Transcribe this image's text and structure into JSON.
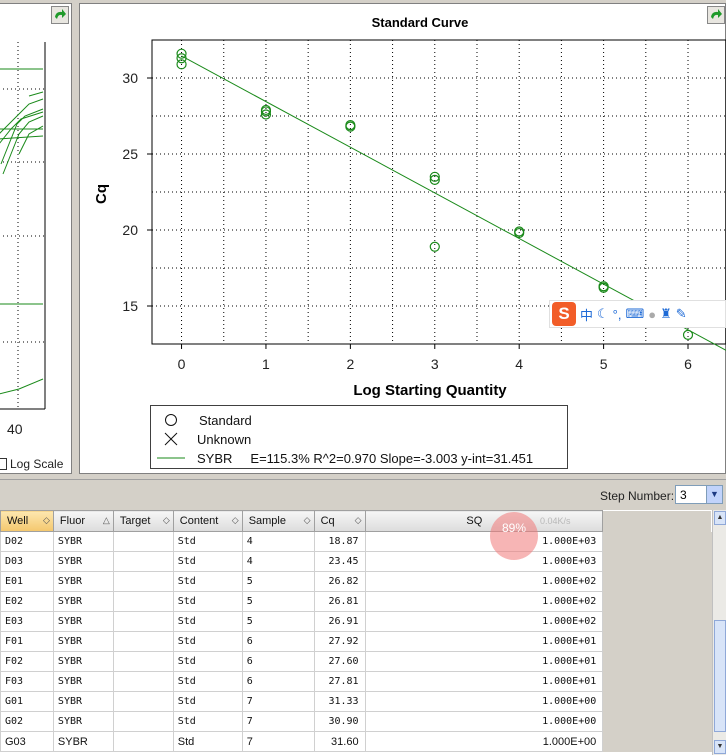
{
  "left_panel": {
    "x_tick": "40",
    "log_scale_label": "Log Scale"
  },
  "chart_data": {
    "type": "scatter",
    "title": "Standard Curve",
    "xlabel": "Log Starting Quantity",
    "ylabel": "Cq",
    "xlim": [
      -0.35,
      6.45
    ],
    "ylim": [
      12.5,
      32.5
    ],
    "x_ticks": [
      "0",
      "1",
      "2",
      "3",
      "4",
      "5",
      "6"
    ],
    "y_ticks": [
      "15",
      "20",
      "25",
      "30"
    ],
    "grid": true,
    "color": "#1a8a1a",
    "points": [
      [
        0,
        31.6
      ],
      [
        0,
        31.3
      ],
      [
        0,
        30.9
      ],
      [
        1,
        27.9
      ],
      [
        1,
        27.8
      ],
      [
        1,
        27.6
      ],
      [
        2,
        26.9
      ],
      [
        2,
        26.8
      ],
      [
        3,
        23.5
      ],
      [
        3,
        23.3
      ],
      [
        3,
        18.9
      ],
      [
        4,
        19.9
      ],
      [
        4,
        19.8
      ],
      [
        5,
        16.3
      ],
      [
        5,
        16.2
      ],
      [
        6,
        13.1
      ]
    ],
    "fit_line": {
      "slope": -3.003,
      "intercept": 31.451
    },
    "legend": [
      {
        "symbol": "circle",
        "label": "Standard"
      },
      {
        "symbol": "cross",
        "label": "Unknown"
      },
      {
        "symbol": "line",
        "label": "SYBR",
        "stats": "E=115.3% R^2=0.970 Slope=-3.003 y-int=31.451"
      }
    ],
    "legend_position": "bottom"
  },
  "step": {
    "label": "Step Number:",
    "value": "3"
  },
  "table": {
    "headers": [
      "Well",
      "Fluor",
      "Target",
      "Content",
      "Sample",
      "Cq",
      "SQ"
    ],
    "rows": [
      [
        "D02",
        "SYBR",
        "",
        "Std",
        "4",
        "18.87",
        "1.000E+03"
      ],
      [
        "D03",
        "SYBR",
        "",
        "Std",
        "4",
        "23.45",
        "1.000E+03"
      ],
      [
        "E01",
        "SYBR",
        "",
        "Std",
        "5",
        "26.82",
        "1.000E+02"
      ],
      [
        "E02",
        "SYBR",
        "",
        "Std",
        "5",
        "26.81",
        "1.000E+02"
      ],
      [
        "E03",
        "SYBR",
        "",
        "Std",
        "5",
        "26.91",
        "1.000E+02"
      ],
      [
        "F01",
        "SYBR",
        "",
        "Std",
        "6",
        "27.92",
        "1.000E+01"
      ],
      [
        "F02",
        "SYBR",
        "",
        "Std",
        "6",
        "27.60",
        "1.000E+01"
      ],
      [
        "F03",
        "SYBR",
        "",
        "Std",
        "6",
        "27.81",
        "1.000E+01"
      ],
      [
        "G01",
        "SYBR",
        "",
        "Std",
        "7",
        "31.33",
        "1.000E+00"
      ],
      [
        "G02",
        "SYBR",
        "",
        "Std",
        "7",
        "30.90",
        "1.000E+00"
      ],
      [
        "G03",
        "SYBR",
        "",
        "Std",
        "7",
        "31.60",
        "1.000E+00"
      ]
    ]
  },
  "overlay": {
    "ime_logo": "S",
    "ime_char": "中",
    "speed_pct": "89%",
    "speed_rate": "0.04K/s"
  }
}
